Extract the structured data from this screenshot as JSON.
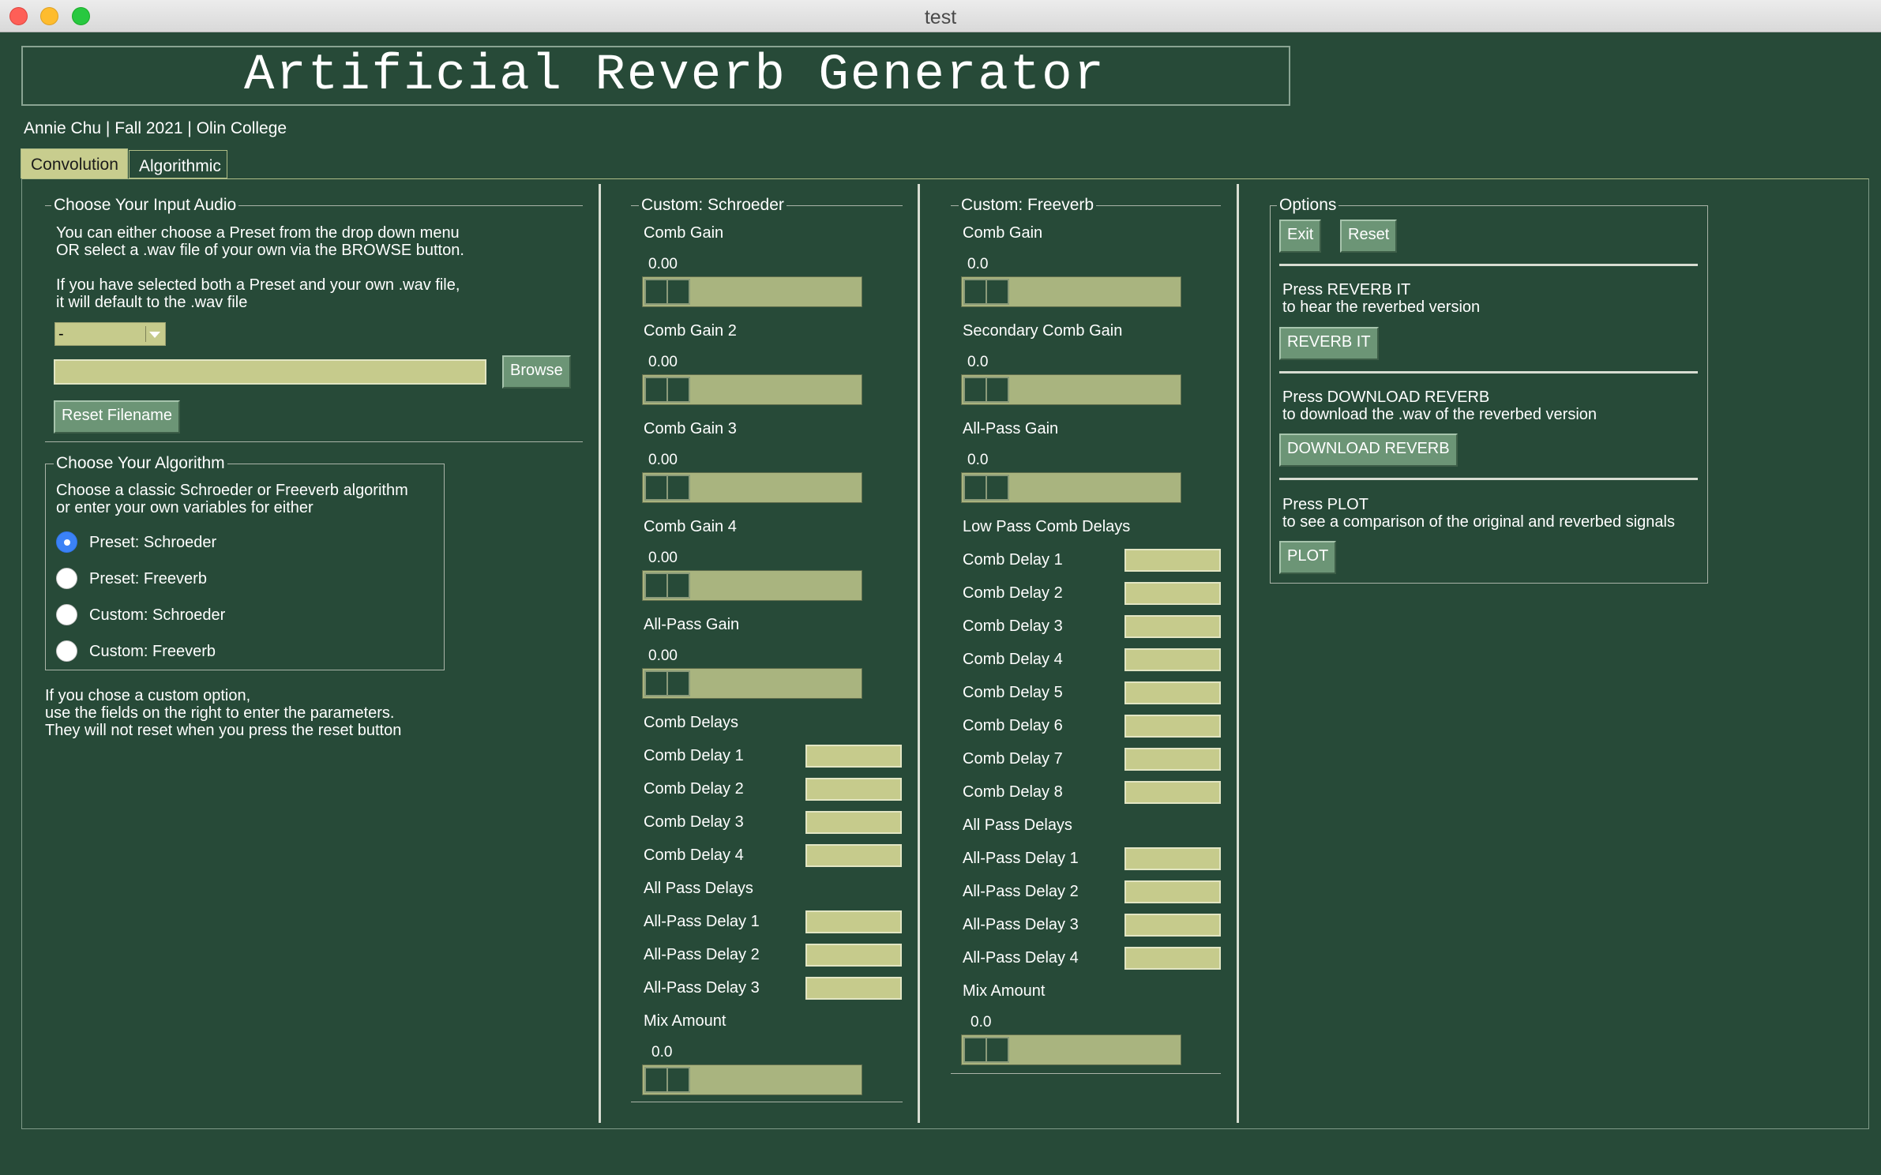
{
  "window": {
    "title": "test"
  },
  "header": {
    "title": "Artificial Reverb Generator",
    "subtitle": "Annie Chu | Fall 2021 | Olin College"
  },
  "tabs": [
    {
      "label": "Convolution",
      "selected": true
    },
    {
      "label": "Algorithmic",
      "selected": false
    }
  ],
  "input_audio": {
    "legend": "Choose Your Input Audio",
    "text1": "You can either choose a Preset from the drop down menu\nOR select a .wav file of your own via the BROWSE button.",
    "text2": "If you have selected both a Preset and your own .wav file,\nit will default to the .wav file",
    "preset_value": "-",
    "filename_value": "",
    "browse_label": "Browse",
    "reset_filename_label": "Reset Filename"
  },
  "algorithm": {
    "legend": "Choose Your Algorithm",
    "text": "Choose a classic Schroeder or Freeverb algorithm\nor enter your own variables for either",
    "options": [
      {
        "label": "Preset: Schroeder",
        "selected": true
      },
      {
        "label": "Preset: Freeverb",
        "selected": false
      },
      {
        "label": "Custom: Schroeder",
        "selected": false
      },
      {
        "label": "Custom: Freeverb",
        "selected": false
      }
    ],
    "note": "If you chose a custom option,\nuse the fields on the right to enter the parameters.\nThey will not reset when you press the reset button"
  },
  "schroeder": {
    "legend": "Custom: Schroeder",
    "sliders": [
      {
        "label": "Comb Gain",
        "value": "0.00"
      },
      {
        "label": "Comb Gain 2",
        "value": "0.00"
      },
      {
        "label": "Comb Gain 3",
        "value": "0.00"
      },
      {
        "label": "Comb Gain 4",
        "value": "0.00"
      },
      {
        "label": "All-Pass Gain",
        "value": "0.00"
      }
    ],
    "comb_delays_heading": "Comb Delays",
    "comb_delays": [
      "Comb Delay 1",
      "Comb Delay 2",
      "Comb Delay 3",
      "Comb Delay 4"
    ],
    "allpass_delays_heading": "All Pass Delays",
    "allpass_delays": [
      "All-Pass Delay 1",
      "All-Pass Delay 2",
      "All-Pass Delay 3"
    ],
    "mix": {
      "label": "Mix Amount",
      "value": "0.0"
    }
  },
  "freeverb": {
    "legend": "Custom: Freeverb",
    "sliders": [
      {
        "label": "Comb Gain",
        "value": "0.0"
      },
      {
        "label": "Secondary Comb Gain",
        "value": "0.0"
      },
      {
        "label": "All-Pass Gain",
        "value": "0.0"
      }
    ],
    "comb_delays_heading": "Low Pass Comb Delays",
    "comb_delays": [
      "Comb Delay 1",
      "Comb Delay 2",
      "Comb Delay 3",
      "Comb Delay 4",
      "Comb Delay 5",
      "Comb Delay 6",
      "Comb Delay 7",
      "Comb Delay 8"
    ],
    "allpass_delays_heading": "All Pass Delays",
    "allpass_delays": [
      "All-Pass Delay 1",
      "All-Pass Delay 2",
      "All-Pass Delay 3",
      "All-Pass Delay 4"
    ],
    "mix": {
      "label": "Mix Amount",
      "value": "0.0"
    }
  },
  "options": {
    "legend": "Options",
    "exit_label": "Exit",
    "reset_label": "Reset",
    "reverb_text": "Press REVERB IT\nto hear the reverbed version",
    "reverb_label": "REVERB IT",
    "download_text": "Press DOWNLOAD REVERB\nto download the .wav of the reverbed version",
    "download_label": "DOWNLOAD REVERB",
    "plot_text": "Press PLOT\nto see a comparison of the original and reverbed signals",
    "plot_label": "PLOT"
  }
}
